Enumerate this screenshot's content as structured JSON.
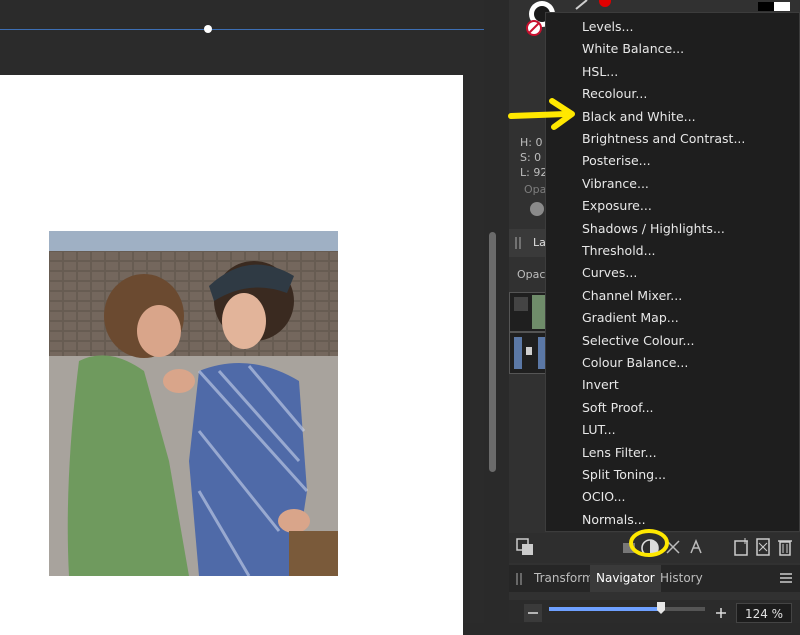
{
  "menu": {
    "items": [
      "Levels...",
      "White Balance...",
      "HSL...",
      "Recolour...",
      "Black and White...",
      "Brightness and Contrast...",
      "Posterise...",
      "Vibrance...",
      "Exposure...",
      "Shadows / Highlights...",
      "Threshold...",
      "Curves...",
      "Channel Mixer...",
      "Gradient Map...",
      "Selective Colour...",
      "Colour Balance...",
      "Invert",
      "Soft Proof...",
      "LUT...",
      "Lens Filter...",
      "Split Toning...",
      "OCIO...",
      "Normals..."
    ]
  },
  "color_panel": {
    "h": "H: 0",
    "s": "S: 0",
    "l": "L: 92",
    "opacity_label": "Opa"
  },
  "layers_panel": {
    "tab_label": "La",
    "opacity_label": "Opaci"
  },
  "bottom_tabs": {
    "transform": "Transform",
    "navigator": "Navigator",
    "history": "History"
  },
  "navigator": {
    "zoom_value": "124 %",
    "zoom_fraction": 0.6
  },
  "colors": {
    "annotation": "#ffe800",
    "accent_blue": "#3d6fb4",
    "menu_bg": "#1e1e1e"
  }
}
